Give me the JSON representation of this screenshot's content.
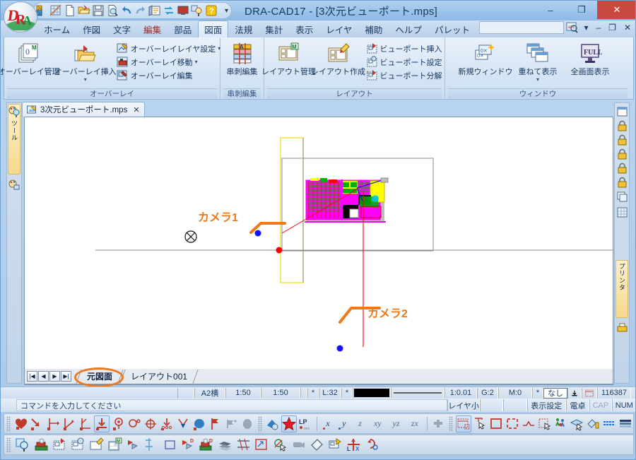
{
  "window": {
    "title": "DRA-CAD17 - [3次元ビューポート.mps]",
    "minimize": "–",
    "maximize": "❐",
    "close": "✕"
  },
  "quick_access": {
    "caret": "▾",
    "items": [
      {
        "name": "2d3d-toggle-icon",
        "label": "2D3D"
      },
      {
        "name": "grid-snap-icon",
        "label": "グリッド"
      },
      {
        "name": "new-file-icon",
        "label": "新規"
      },
      {
        "name": "open-file-icon",
        "label": "開く"
      },
      {
        "name": "save-file-icon",
        "label": "上書き保存"
      },
      {
        "name": "print-preview-icon",
        "label": "印刷プレビュー"
      },
      {
        "name": "undo-icon",
        "label": "元に戻す"
      },
      {
        "name": "redo-icon",
        "label": "やり直し"
      },
      {
        "name": "properties-icon",
        "label": "属性"
      },
      {
        "name": "refresh-icon",
        "label": "再描画"
      },
      {
        "name": "display-icon",
        "label": "画面"
      },
      {
        "name": "zoom-tool-icon",
        "label": "ズーム"
      },
      {
        "name": "help-icon",
        "label": "ヘルプ"
      }
    ]
  },
  "menubar": {
    "items": [
      {
        "label": "ホーム",
        "active": false,
        "red": false
      },
      {
        "label": "作図",
        "active": false,
        "red": false
      },
      {
        "label": "文字",
        "active": false,
        "red": false
      },
      {
        "label": "編集",
        "active": false,
        "red": true
      },
      {
        "label": "部品",
        "active": false,
        "red": false
      },
      {
        "label": "図面",
        "active": true,
        "red": false
      },
      {
        "label": "法規",
        "active": false,
        "red": false
      },
      {
        "label": "集計",
        "active": false,
        "red": false
      },
      {
        "label": "表示",
        "active": false,
        "red": false
      },
      {
        "label": "レイヤ",
        "active": false,
        "red": false
      },
      {
        "label": "補助",
        "active": false,
        "red": false
      },
      {
        "label": "ヘルプ",
        "active": false,
        "red": false
      },
      {
        "label": "パレット",
        "active": false,
        "red": false
      }
    ],
    "palette_caret": "▾",
    "search_value": "",
    "search_placeholder": "",
    "find_caret": "▾",
    "min": "–",
    "restore": "❐",
    "close": "✕"
  },
  "ribbon": {
    "groups": [
      {
        "title": "オーバーレイ",
        "big_buttons": [
          {
            "label": "オーバーレイ管理",
            "icon": "overlay-manage-icon",
            "caret": ""
          },
          {
            "label": "オーバーレイ挿入",
            "icon": "overlay-insert-icon",
            "caret": "▾"
          }
        ],
        "small_buttons": [
          {
            "label": "オーバーレイレイヤ設定",
            "icon": "overlay-layer-settings-icon",
            "caret": "▾"
          },
          {
            "label": "オーバーレイ移動",
            "icon": "overlay-move-icon",
            "caret": "▾"
          },
          {
            "label": "オーバーレイ編集",
            "icon": "overlay-edit-icon",
            "caret": ""
          }
        ]
      },
      {
        "title": "串刺編集",
        "big_buttons": [
          {
            "label": "串刺編集",
            "icon": "skewer-edit-icon",
            "caret": ""
          }
        ],
        "small_buttons": []
      },
      {
        "title": "レイアウト",
        "big_buttons": [
          {
            "label": "レイアウト管理",
            "icon": "layout-manage-icon",
            "caret": ""
          },
          {
            "label": "レイアウト作成",
            "icon": "layout-create-icon",
            "caret": ""
          }
        ],
        "small_buttons": [
          {
            "label": "ビューポート挿入",
            "icon": "viewport-insert-icon",
            "caret": ""
          },
          {
            "label": "ビューポート設定",
            "icon": "viewport-settings-icon",
            "caret": ""
          },
          {
            "label": "ビューポート分解",
            "icon": "viewport-explode-icon",
            "caret": ""
          }
        ]
      },
      {
        "title": "ウィンドウ",
        "big_buttons": [
          {
            "label": "新規ウィンドウ",
            "icon": "new-window-icon",
            "caret": ""
          },
          {
            "label": "重ねて表示",
            "icon": "cascade-windows-icon",
            "caret": "▾"
          },
          {
            "label": "全画面表示",
            "icon": "fullscreen-icon",
            "caret": ""
          }
        ],
        "small_buttons": []
      }
    ]
  },
  "document_tab": {
    "label": "3次元ビューポート.mps",
    "close": "✕"
  },
  "sheet_tabs": {
    "nav": [
      "|◀",
      "◀",
      "▶",
      "▶|"
    ],
    "tabs": [
      {
        "label": "元図面",
        "active": true
      },
      {
        "label": "レイアウト001",
        "active": false
      }
    ]
  },
  "canvas": {
    "annotations": [
      {
        "name": "camera-1-label",
        "text": "カメラ1"
      },
      {
        "name": "camera-2-label",
        "text": "カメラ2"
      }
    ]
  },
  "status_bar_top": {
    "cells": [
      {
        "name": "paper-size",
        "text": "A2横"
      },
      {
        "name": "scale-1",
        "text": "1:50"
      },
      {
        "name": "scale-2",
        "text": "1:50"
      },
      {
        "name": "layer-star",
        "text": "*"
      },
      {
        "name": "layer-number",
        "text": "L:32"
      },
      {
        "name": "color-star",
        "text": "*"
      },
      {
        "name": "line-scale",
        "text": "1:0.01"
      },
      {
        "name": "group",
        "text": "G:2"
      },
      {
        "name": "material",
        "text": "M:0"
      },
      {
        "name": "style-star",
        "text": "*"
      },
      {
        "name": "linetype-name",
        "text": "なし"
      },
      {
        "name": "element-count",
        "text": "116387"
      }
    ]
  },
  "status_bar_bottom": {
    "command_prompt": "コマンドを入力してください",
    "cells": [
      {
        "name": "layer-small",
        "text": "レイヤ小"
      },
      {
        "name": "display-settings",
        "text": "表示設定"
      },
      {
        "name": "calculator",
        "text": "電卓"
      },
      {
        "name": "caps-indicator",
        "text": "CAP",
        "dim": true
      },
      {
        "name": "num-indicator",
        "text": "NUM",
        "dim": false
      }
    ]
  },
  "toolbar_snap": {
    "buttons": [
      {
        "name": "snap-free-icon",
        "selected": false
      },
      {
        "name": "snap-endpoint-icon",
        "selected": false
      },
      {
        "name": "snap-intersection-icon",
        "selected": false
      },
      {
        "name": "snap-midpoint-icon",
        "selected": false
      },
      {
        "name": "snap-perpendicular-icon",
        "selected": false
      },
      {
        "name": "snap-nearest-icon",
        "selected": true
      },
      {
        "name": "snap-center-icon",
        "selected": false
      },
      {
        "name": "snap-tangent-icon",
        "selected": false
      },
      {
        "name": "snap-quadrant-icon",
        "selected": false
      },
      {
        "name": "snap-division-icon",
        "selected": false
      },
      {
        "name": "snap-arrow-icon",
        "selected": false
      },
      {
        "name": "snap-vertex-icon",
        "selected": false
      },
      {
        "name": "snap-flag-icon",
        "selected": false
      },
      {
        "name": "snap-node-icon",
        "selected": false
      },
      {
        "name": "snap-solid-icon",
        "selected": false
      }
    ],
    "axis_buttons": [
      {
        "name": "ucs-settings-icon",
        "label": "",
        "selected": false
      },
      {
        "name": "ucs-star-icon",
        "label": "",
        "selected": true
      },
      {
        "name": "ucs-lp-icon",
        "label": "LP",
        "selected": false
      }
    ],
    "axis_labels": [
      {
        "name": "axis-x-button",
        "label": "x",
        "on": true
      },
      {
        "name": "axis-y-button",
        "label": "y",
        "on": true
      },
      {
        "name": "axis-z-button",
        "label": "z",
        "on": false
      },
      {
        "name": "axis-xy-button",
        "label": "xy",
        "on": false
      },
      {
        "name": "axis-yz-button",
        "label": "yz",
        "on": false
      },
      {
        "name": "axis-zx-button",
        "label": "zx",
        "on": false
      }
    ],
    "select_buttons": [
      {
        "name": "select-viewport-icon",
        "selected": true
      },
      {
        "name": "select-pointer-icon",
        "selected": false
      },
      {
        "name": "select-rect-icon",
        "selected": false
      },
      {
        "name": "select-crossing-icon",
        "selected": false
      },
      {
        "name": "select-polyline-icon",
        "selected": false
      },
      {
        "name": "select-fence-icon",
        "selected": false
      },
      {
        "name": "select-people-icon",
        "selected": false
      },
      {
        "name": "select-plane-icon",
        "selected": false
      },
      {
        "name": "select-paint-icon",
        "selected": false
      },
      {
        "name": "select-table-icon",
        "selected": false
      },
      {
        "name": "select-layers-icon",
        "selected": false
      }
    ]
  },
  "toolbar_view": {
    "buttons": [
      {
        "name": "zoom-window-icon"
      },
      {
        "name": "render-view-icon"
      },
      {
        "name": "viewport-insert-tool-icon"
      },
      {
        "name": "viewport-settings-tool-icon"
      },
      {
        "name": "viewport-edit-tool-icon"
      },
      {
        "name": "viewport-manage-tool-icon"
      },
      {
        "name": "view-direction-icon"
      },
      {
        "name": "section-line-icon"
      },
      {
        "name": "rect-frame-icon"
      },
      {
        "name": "view-direction-3d-icon"
      },
      {
        "name": "render-3d-icon"
      },
      {
        "name": "layers-stack-icon"
      },
      {
        "name": "hatch-cross-icon"
      },
      {
        "name": "viewport-redraw-icon"
      },
      {
        "name": "pick-viewport-icon"
      },
      {
        "name": "camera-icon"
      },
      {
        "name": "eraser-icon"
      },
      {
        "name": "viewport-copy-icon"
      },
      {
        "name": "ucs-axis-icon"
      },
      {
        "name": "ucs-rotate-icon"
      }
    ]
  }
}
